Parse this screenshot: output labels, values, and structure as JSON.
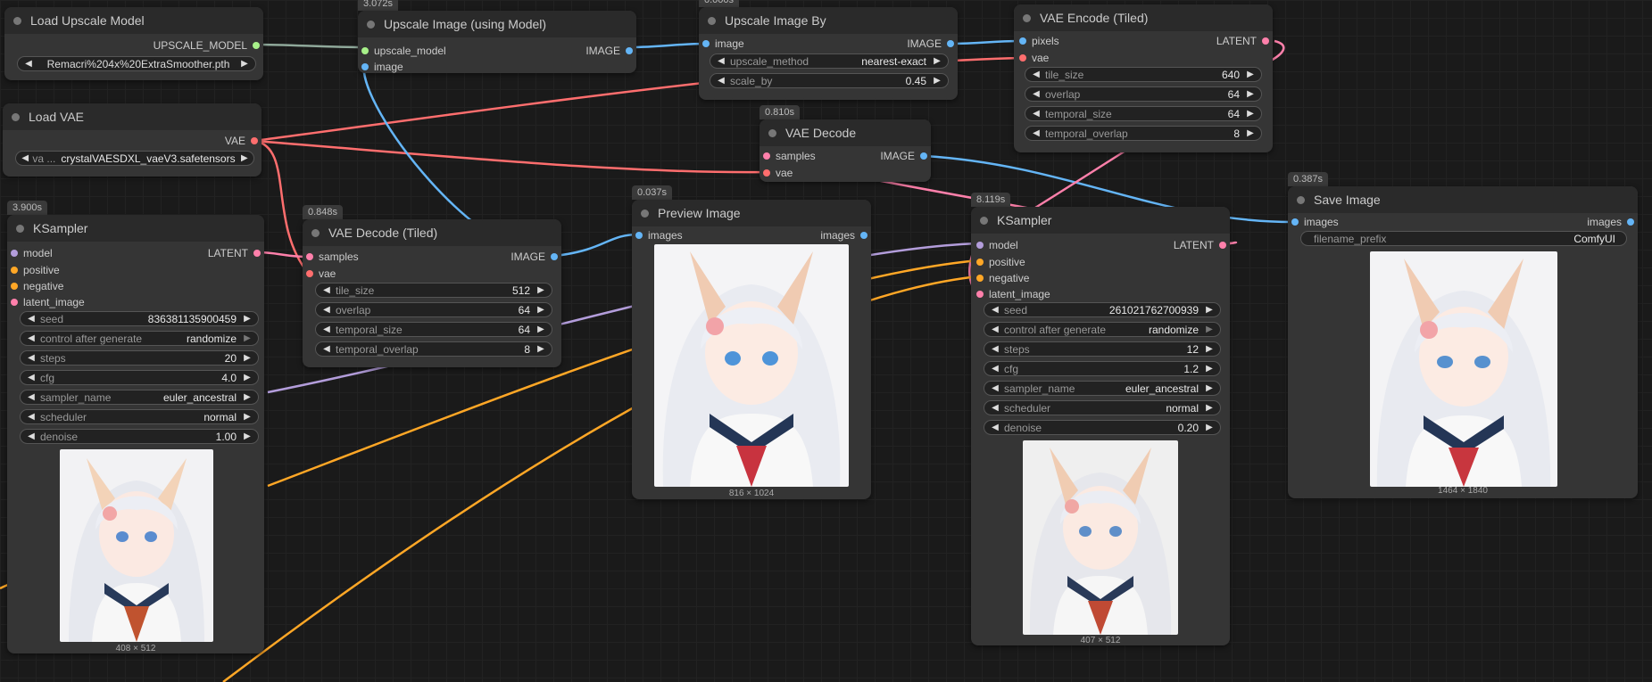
{
  "colors": {
    "model": "#b39ddb",
    "conditioning": "#ffa726",
    "latent": "#ff80ab",
    "image": "#64b5f6",
    "vae": "#ff6e6e",
    "upscale_model": "#a7f089"
  },
  "load_upscale": {
    "title": "Load Upscale Model",
    "out": "UPSCALE_MODEL",
    "model_name": "Remacri%204x%20ExtraSmoother.pth"
  },
  "upscale_using": {
    "badge": "3.072s",
    "title": "Upscale Image (using Model)",
    "in_model": "upscale_model",
    "in_image": "image",
    "out": "IMAGE"
  },
  "upscale_by": {
    "badge": "0.000s",
    "title": "Upscale Image By",
    "in_image": "image",
    "out": "IMAGE",
    "method_label": "upscale_method",
    "method_value": "nearest-exact",
    "scale_label": "scale_by",
    "scale_value": "0.45"
  },
  "vae_encode": {
    "title": "VAE Encode (Tiled)",
    "in_pixels": "pixels",
    "in_vae": "vae",
    "out": "LATENT",
    "w": [
      {
        "l": "tile_size",
        "v": "640"
      },
      {
        "l": "overlap",
        "v": "64"
      },
      {
        "l": "temporal_size",
        "v": "64"
      },
      {
        "l": "temporal_overlap",
        "v": "8"
      }
    ]
  },
  "load_vae": {
    "title": "Load VAE",
    "out": "VAE",
    "vae_label": "va ...",
    "vae_value": "crystalVAESDXL_vaeV3.safetensors"
  },
  "vae_decode": {
    "badge": "0.810s",
    "title": "VAE Decode",
    "in_samples": "samples",
    "in_vae": "vae",
    "out": "IMAGE"
  },
  "ksampler1": {
    "badge": "3.900s",
    "title": "KSampler",
    "in_model": "model",
    "in_positive": "positive",
    "in_negative": "negative",
    "in_latent": "latent_image",
    "out": "LATENT",
    "w": [
      {
        "l": "seed",
        "v": "836381135900459"
      },
      {
        "l": "control after generate",
        "v": "randomize"
      },
      {
        "l": "steps",
        "v": "20"
      },
      {
        "l": "cfg",
        "v": "4.0"
      },
      {
        "l": "sampler_name",
        "v": "euler_ancestral"
      },
      {
        "l": "scheduler",
        "v": "normal"
      },
      {
        "l": "denoise",
        "v": "1.00"
      }
    ],
    "dims": "408 × 512"
  },
  "vae_decode_tiled": {
    "badge": "0.848s",
    "title": "VAE Decode (Tiled)",
    "in_samples": "samples",
    "in_vae": "vae",
    "out": "IMAGE",
    "w": [
      {
        "l": "tile_size",
        "v": "512"
      },
      {
        "l": "overlap",
        "v": "64"
      },
      {
        "l": "temporal_size",
        "v": "64"
      },
      {
        "l": "temporal_overlap",
        "v": "8"
      }
    ]
  },
  "preview": {
    "badge": "0.037s",
    "title": "Preview Image",
    "in_images": "images",
    "out": "images",
    "dims": "816 × 1024"
  },
  "ksampler2": {
    "badge": "8.119s",
    "title": "KSampler",
    "in_model": "model",
    "in_positive": "positive",
    "in_negative": "negative",
    "in_latent": "latent_image",
    "out": "LATENT",
    "w": [
      {
        "l": "seed",
        "v": "261021762700939"
      },
      {
        "l": "control after generate",
        "v": "randomize"
      },
      {
        "l": "steps",
        "v": "12"
      },
      {
        "l": "cfg",
        "v": "1.2"
      },
      {
        "l": "sampler_name",
        "v": "euler_ancestral"
      },
      {
        "l": "scheduler",
        "v": "normal"
      },
      {
        "l": "denoise",
        "v": "0.20"
      }
    ],
    "dims": "407 × 512"
  },
  "save": {
    "badge": "0.387s",
    "title": "Save Image",
    "in_images": "images",
    "out": "images",
    "prefix_label": "filename_prefix",
    "prefix_value": "ComfyUI",
    "dims": "1464 × 1840"
  }
}
